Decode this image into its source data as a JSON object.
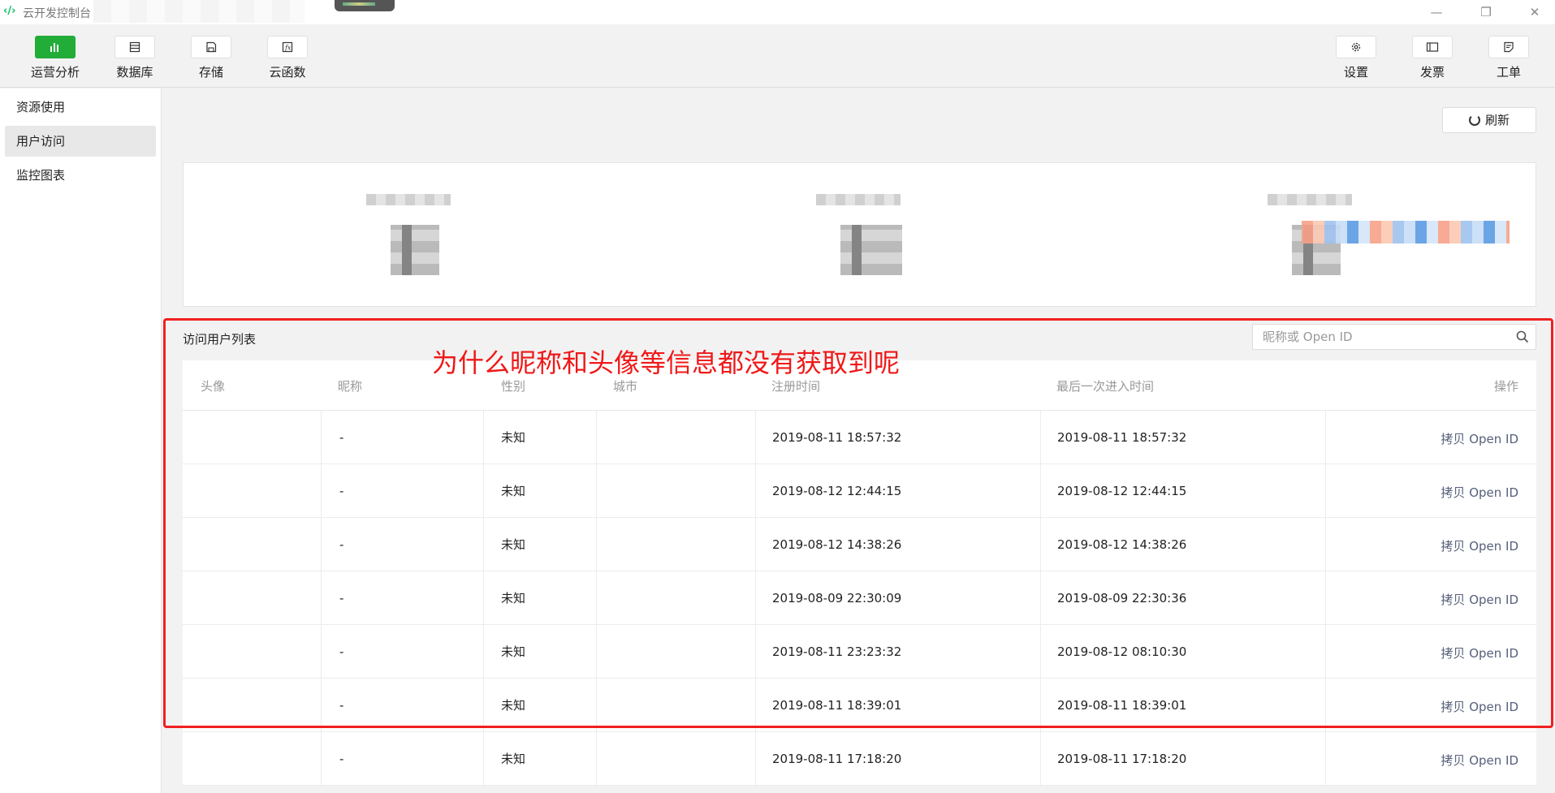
{
  "window": {
    "title": "云开发控制台",
    "app_icon": "‹/›"
  },
  "toolbar": {
    "left": [
      {
        "label": "运营分析",
        "icon": "chart-icon",
        "active": true
      },
      {
        "label": "数据库",
        "icon": "database-icon",
        "active": false
      },
      {
        "label": "存储",
        "icon": "storage-icon",
        "active": false
      },
      {
        "label": "云函数",
        "icon": "function-icon",
        "active": false
      }
    ],
    "right": [
      {
        "label": "设置",
        "icon": "gear-icon"
      },
      {
        "label": "发票",
        "icon": "invoice-icon"
      },
      {
        "label": "工单",
        "icon": "ticket-icon"
      }
    ]
  },
  "sidebar": {
    "items": [
      {
        "label": "资源使用",
        "active": false
      },
      {
        "label": "用户访问",
        "active": true
      },
      {
        "label": "监控图表",
        "active": false
      }
    ]
  },
  "main": {
    "refresh_label": "刷新",
    "list_title": "访问用户列表",
    "search_placeholder": "昵称或 Open ID"
  },
  "table": {
    "headers": [
      "头像",
      "昵称",
      "性别",
      "城市",
      "注册时间",
      "最后一次进入时间",
      "操作"
    ],
    "rows": [
      {
        "avatar": "",
        "nickname": "-",
        "gender": "未知",
        "city": "",
        "registered": "2019-08-11 18:57:32",
        "last_visit": "2019-08-11 18:57:32",
        "action": "拷贝 Open ID"
      },
      {
        "avatar": "",
        "nickname": "-",
        "gender": "未知",
        "city": "",
        "registered": "2019-08-12 12:44:15",
        "last_visit": "2019-08-12 12:44:15",
        "action": "拷贝 Open ID"
      },
      {
        "avatar": "",
        "nickname": "-",
        "gender": "未知",
        "city": "",
        "registered": "2019-08-12 14:38:26",
        "last_visit": "2019-08-12 14:38:26",
        "action": "拷贝 Open ID"
      },
      {
        "avatar": "",
        "nickname": "-",
        "gender": "未知",
        "city": "",
        "registered": "2019-08-09 22:30:09",
        "last_visit": "2019-08-09 22:30:36",
        "action": "拷贝 Open ID"
      },
      {
        "avatar": "",
        "nickname": "-",
        "gender": "未知",
        "city": "",
        "registered": "2019-08-11 23:23:32",
        "last_visit": "2019-08-12 08:10:30",
        "action": "拷贝 Open ID"
      },
      {
        "avatar": "",
        "nickname": "-",
        "gender": "未知",
        "city": "",
        "registered": "2019-08-11 18:39:01",
        "last_visit": "2019-08-11 18:39:01",
        "action": "拷贝 Open ID"
      },
      {
        "avatar": "",
        "nickname": "-",
        "gender": "未知",
        "city": "",
        "registered": "2019-08-11 17:18:20",
        "last_visit": "2019-08-11 17:18:20",
        "action": "拷贝 Open ID"
      }
    ]
  },
  "annotation": {
    "text": "为什么昵称和头像等信息都没有获取到呢",
    "color": "#f01818"
  },
  "colors": {
    "accent": "#22ac38",
    "link": "#56607a",
    "annotation": "#f02020"
  }
}
